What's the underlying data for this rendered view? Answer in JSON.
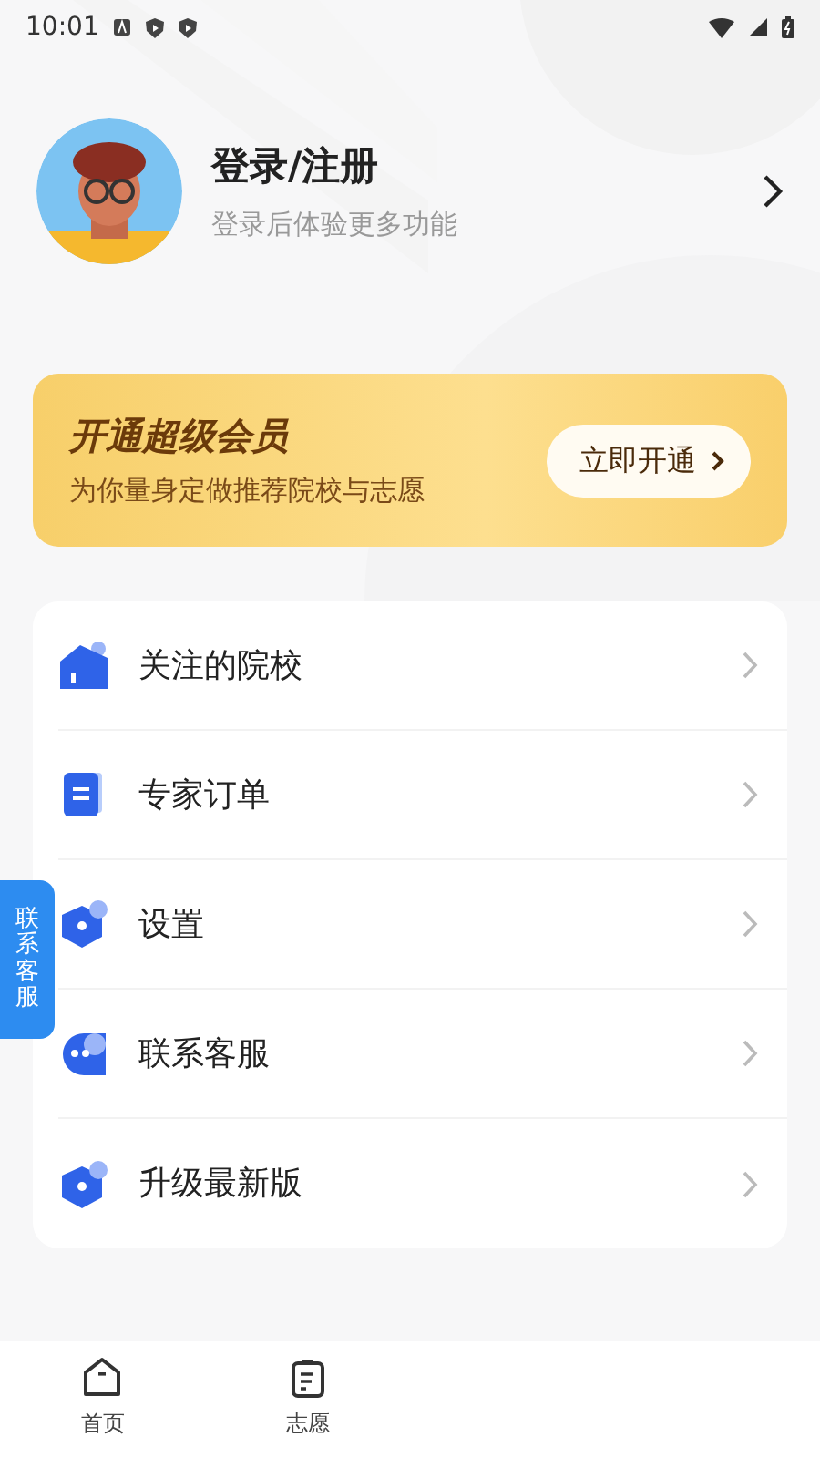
{
  "status_bar": {
    "time": "10:01"
  },
  "profile": {
    "title": "登录/注册",
    "subtitle": "登录后体验更多功能"
  },
  "vip_banner": {
    "title": "开通超级会员",
    "subtitle": "为你量身定做推荐院校与志愿",
    "button": "立即开通"
  },
  "menu": [
    {
      "label": "关注的院校",
      "kind": "house"
    },
    {
      "label": "专家订单",
      "kind": "doc"
    },
    {
      "label": "设置",
      "kind": "hex"
    },
    {
      "label": "联系客服",
      "kind": "chat"
    },
    {
      "label": "升级最新版",
      "kind": "hex"
    }
  ],
  "floating_tab": {
    "label": "联系客服"
  },
  "bottom_nav": [
    {
      "label": "首页",
      "kind": "home"
    },
    {
      "label": "志愿",
      "kind": "clipboard"
    }
  ]
}
